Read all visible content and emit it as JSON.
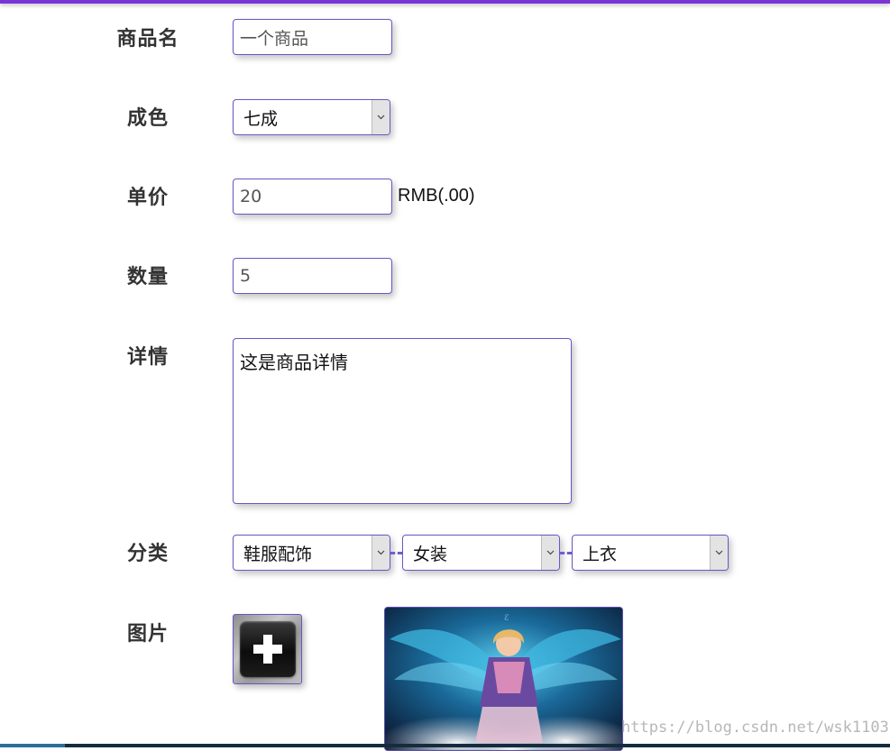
{
  "form": {
    "name_label": "商品名",
    "name_value": "一个商品",
    "condition_label": "成色",
    "condition_value": "七成",
    "price_label": "单价",
    "price_value": "20",
    "price_unit": "RMB(.00)",
    "quantity_label": "数量",
    "quantity_value": "5",
    "detail_label": "详情",
    "detail_value": "这是商品详情",
    "category_label": "分类",
    "category_level1": "鞋服配饰",
    "category_level2": "女装",
    "category_level3": "上衣",
    "image_label": "图片"
  },
  "watermark": "https://blog.csdn.net/wsk1103",
  "colors": {
    "accent": "#7b35d6",
    "field_border": "#6a55c8",
    "label_text": "#333333"
  },
  "icons": {
    "upload": "plus-icon",
    "dropdown": "chevron-down-icon"
  }
}
